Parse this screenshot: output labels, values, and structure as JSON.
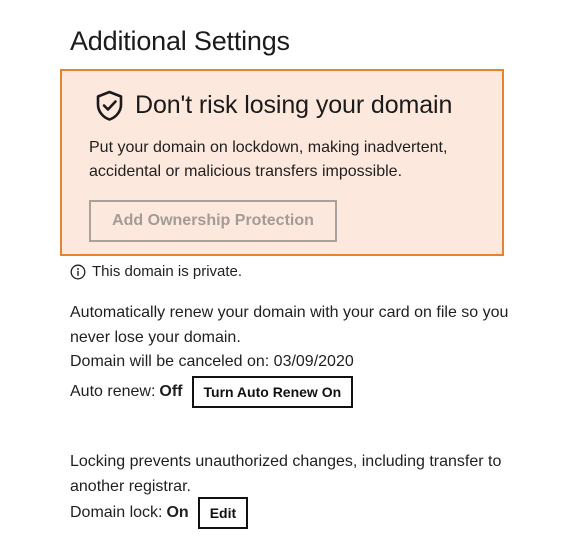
{
  "page": {
    "title": "Additional Settings"
  },
  "protection_promo": {
    "heading": "Don't risk losing your domain",
    "body": "Put your domain on lockdown, making inadvertent, accidental or malicious transfers impossible.",
    "button_label": "Add Ownership Protection",
    "icon": "shield-check-icon",
    "background_color": "#fde8dd",
    "border_color": "#e8822e"
  },
  "privacy": {
    "icon": "info-icon",
    "text": "This domain is private."
  },
  "auto_renew": {
    "description": "Automatically renew your domain with your card on file so you never lose your domain.",
    "cancel_notice": "Domain will be canceled on: 03/09/2020",
    "label": "Auto renew:",
    "value": "Off",
    "button_label": "Turn Auto Renew On"
  },
  "domain_lock": {
    "description": "Locking prevents unauthorized changes, including transfer to another registrar.",
    "label": "Domain lock:",
    "value": "On",
    "button_label": "Edit"
  }
}
